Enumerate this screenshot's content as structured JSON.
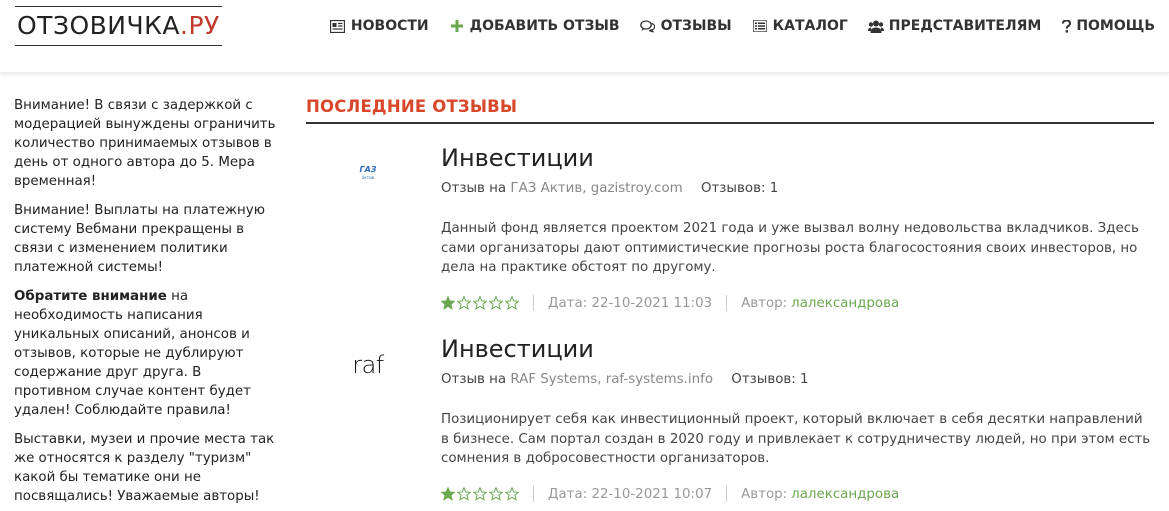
{
  "header": {
    "logo_main": "ОТЗОВИЧКА",
    "logo_dot": ".",
    "logo_tld": "РУ",
    "nav": [
      {
        "label": "НОВОСТИ",
        "icon": "newspaper-icon"
      },
      {
        "label": "ДОБАВИТЬ ОТЗЫВ",
        "icon": "plus-icon"
      },
      {
        "label": "ОТЗЫВЫ",
        "icon": "comments-icon"
      },
      {
        "label": "КАТАЛОГ",
        "icon": "list-icon"
      },
      {
        "label": "ПРЕДСТАВИТЕЛЯМ",
        "icon": "users-icon"
      },
      {
        "label": "ПОМОЩЬ",
        "icon": "question-icon"
      }
    ]
  },
  "sidebar": {
    "notice1": "Внимание! В связи с задержкой с модерацией вынуждены ограничить количество принимаемых отзывов в день от одного автора до 5. Мера временная!",
    "notice2": "Внимание! Выплаты на платежную систему Вебмани прекращены в связи с изменением политики платежной системы!",
    "notice3_bold": "Обратите внимание",
    "notice3_rest": " на необходимость написания уникальных описаний, анонсов и отзывов, которые не дублируют содержание друг друга. В противном случае контент будет удален! Соблюдайте правила!",
    "notice4": "Выставки, музеи и прочие места так же относятся к разделу \"туризм\" какой бы тематике они не посвящались! Уважаемые авторы!"
  },
  "main": {
    "section_title": "ПОСЛЕДНИЕ ОТЗЫВЫ",
    "reviews": [
      {
        "logo_text": "ГАЗ",
        "logo_sub": "актив",
        "title": "Инвестиции",
        "meta_prefix": "Отзыв на",
        "company": "ГАЗ Актив, gazistroy.com",
        "count_label": "Отзывов: 1",
        "text": "Данный фонд является проектом 2021 года и уже вызвал волну недовольства вкладчиков. Здесь сами организаторы дают оптимистические прогнозы роста благосостояния своих инвесторов, но дела на практике обстоят по другому.",
        "rating": 1,
        "rating_max": 5,
        "date": "Дата: 22-10-2021 11:03",
        "author_label": "Автор:",
        "author": "лалександрова"
      },
      {
        "logo_text": "raf",
        "title": "Инвестиции",
        "meta_prefix": "Отзыв на",
        "company": "RAF Systems, raf-systems.info",
        "count_label": "Отзывов: 1",
        "text": "Позиционирует себя как инвестиционный проект, который включает в себя десятки направлений в бизнесе. Сам портал создан в 2020 году и привлекает к сотрудничеству людей, но при этом есть сомнения в добросовестности организаторов.",
        "rating": 1,
        "rating_max": 5,
        "date": "Дата: 22-10-2021 10:07",
        "author_label": "Автор:",
        "author": "лалександрова"
      }
    ]
  },
  "colors": {
    "accent": "#d9472b",
    "star": "#6aa84f",
    "link": "#6aa84f"
  }
}
